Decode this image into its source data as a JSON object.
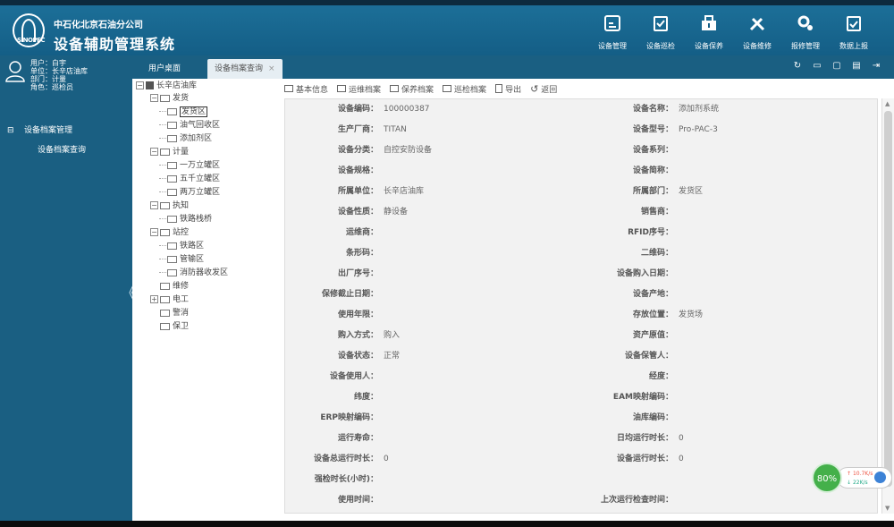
{
  "header": {
    "logo_text": "SINOPEC",
    "company": "中石化北京石油分公司",
    "title": "设备辅助管理系统",
    "nav": [
      {
        "label": "设备管理",
        "icon": "equipment-management-icon"
      },
      {
        "label": "设备巡检",
        "icon": "inspection-icon"
      },
      {
        "label": "设备保养",
        "icon": "maintenance-icon"
      },
      {
        "label": "设备维修",
        "icon": "repair-tools-icon"
      },
      {
        "label": "报修管理",
        "icon": "repair-request-icon"
      },
      {
        "label": "数据上报",
        "icon": "data-report-icon"
      }
    ]
  },
  "user": {
    "name": "用户：白宇",
    "unit": "单位：长辛店油库",
    "dept": "部门：计量",
    "role": "角色：巡检员"
  },
  "sidebar": {
    "group": "设备档案管理",
    "group_toggle": "⊟",
    "item": "设备档案查询",
    "collapse": "《"
  },
  "tabs": [
    {
      "label": "用户桌面"
    },
    {
      "label": "设备档案查询",
      "close": "×"
    }
  ],
  "tree": {
    "root": "长辛店油库",
    "nodes": [
      {
        "label": "发货",
        "level": 1,
        "exp": "−"
      },
      {
        "label": "发货区",
        "level": 2,
        "selected": true
      },
      {
        "label": "油气回收区",
        "level": 2
      },
      {
        "label": "添加剂区",
        "level": 2
      },
      {
        "label": "计量",
        "level": 1,
        "exp": "−"
      },
      {
        "label": "一万立罐区",
        "level": 2
      },
      {
        "label": "五千立罐区",
        "level": 2
      },
      {
        "label": "两万立罐区",
        "level": 2
      },
      {
        "label": "执知",
        "level": 1,
        "exp": "−"
      },
      {
        "label": "铁路栈桥",
        "level": 2
      },
      {
        "label": "站控",
        "level": 1,
        "exp": "−"
      },
      {
        "label": "铁路区",
        "level": 2
      },
      {
        "label": "管输区",
        "level": 2
      },
      {
        "label": "消防器收发区",
        "level": 2
      },
      {
        "label": "维修",
        "level": 1
      },
      {
        "label": "电工",
        "level": 1,
        "exp": "+"
      },
      {
        "label": "警消",
        "level": 1
      },
      {
        "label": "保卫",
        "level": 1
      }
    ]
  },
  "toolbar": [
    {
      "label": "基本信息"
    },
    {
      "label": "运维档案"
    },
    {
      "label": "保养档案"
    },
    {
      "label": "巡检档案"
    },
    {
      "label": "导出"
    },
    {
      "label": "返回"
    }
  ],
  "form_rows": [
    [
      {
        "label": "设备编码：",
        "value": "100000387"
      },
      {
        "label": "设备名称：",
        "value": "添加剂系统"
      }
    ],
    [
      {
        "label": "生产厂商：",
        "value": "TITAN"
      },
      {
        "label": "设备型号：",
        "value": "Pro-PAC-3"
      }
    ],
    [
      {
        "label": "设备分类：",
        "value": "自控安防设备"
      },
      {
        "label": "设备系列：",
        "value": ""
      }
    ],
    [
      {
        "label": "设备规格：",
        "value": ""
      },
      {
        "label": "设备简称：",
        "value": ""
      }
    ],
    [
      {
        "label": "所属单位：",
        "value": "长辛店油库"
      },
      {
        "label": "所属部门：",
        "value": "发货区"
      }
    ],
    [
      {
        "label": "设备性质：",
        "value": "静设备"
      },
      {
        "label": "销售商：",
        "value": ""
      }
    ],
    [
      {
        "label": "运维商：",
        "value": ""
      },
      {
        "label": "RFID序号：",
        "value": ""
      }
    ],
    [
      {
        "label": "条形码：",
        "value": ""
      },
      {
        "label": "二维码：",
        "value": ""
      }
    ],
    [
      {
        "label": "出厂序号：",
        "value": ""
      },
      {
        "label": "设备购入日期：",
        "value": ""
      }
    ],
    [
      {
        "label": "保修截止日期：",
        "value": ""
      },
      {
        "label": "设备产地：",
        "value": ""
      }
    ],
    [
      {
        "label": "使用年限：",
        "value": ""
      },
      {
        "label": "存放位置：",
        "value": "发货场"
      }
    ],
    [
      {
        "label": "购入方式：",
        "value": "购入"
      },
      {
        "label": "资产原值：",
        "value": ""
      }
    ],
    [
      {
        "label": "设备状态：",
        "value": "正常"
      },
      {
        "label": "设备保管人：",
        "value": ""
      }
    ],
    [
      {
        "label": "设备使用人：",
        "value": ""
      },
      {
        "label": "经度：",
        "value": ""
      }
    ],
    [
      {
        "label": "纬度：",
        "value": ""
      },
      {
        "label": "EAM映射编码：",
        "value": ""
      }
    ],
    [
      {
        "label": "ERP映射编码：",
        "value": ""
      },
      {
        "label": "油库编码：",
        "value": ""
      }
    ],
    [
      {
        "label": "运行寿命：",
        "value": ""
      },
      {
        "label": "日均运行时长：",
        "value": "0"
      }
    ],
    [
      {
        "label": "设备总运行时长：",
        "value": "0"
      },
      {
        "label": "设备运行时长：",
        "value": "0"
      }
    ],
    [
      {
        "label": "强检时长(小时)：",
        "value": ""
      },
      {
        "label": "",
        "value": ""
      }
    ],
    [
      {
        "label": "使用时间：",
        "value": ""
      },
      {
        "label": "上次运行检查时间：",
        "value": ""
      }
    ]
  ],
  "speed_widget": {
    "percent": "80%",
    "up": "10.7K/s",
    "down": "22K/s"
  }
}
